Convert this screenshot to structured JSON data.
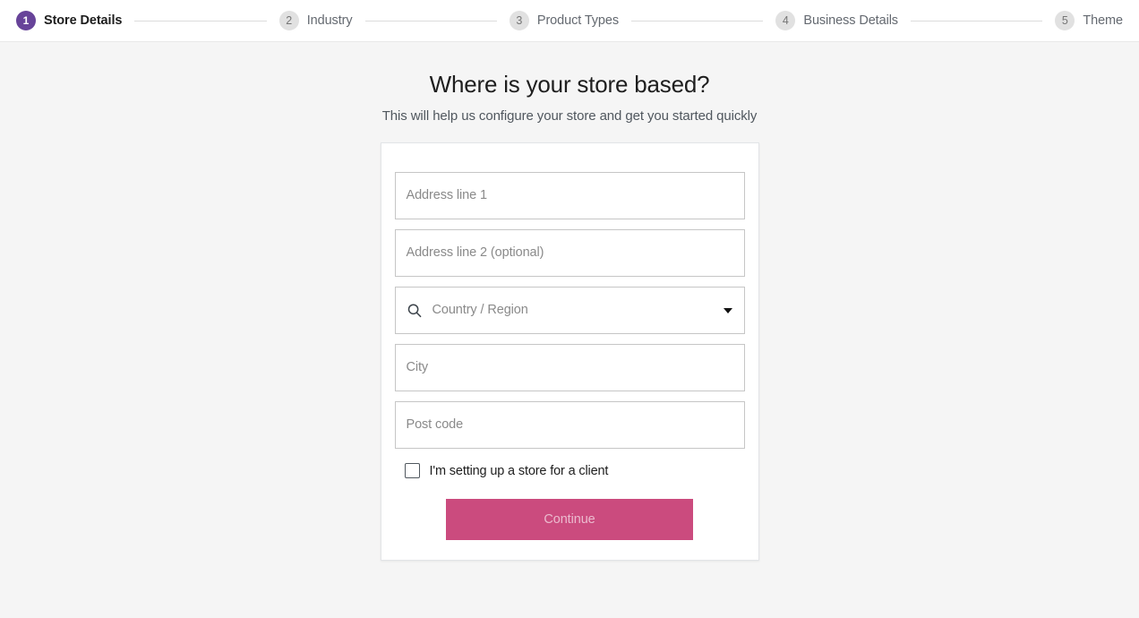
{
  "stepper": {
    "steps": [
      {
        "number": "1",
        "label": "Store Details",
        "state": "active"
      },
      {
        "number": "2",
        "label": "Industry",
        "state": "upcoming"
      },
      {
        "number": "3",
        "label": "Product Types",
        "state": "upcoming"
      },
      {
        "number": "4",
        "label": "Business Details",
        "state": "upcoming"
      },
      {
        "number": "5",
        "label": "Theme",
        "state": "upcoming"
      }
    ],
    "active_color": "#674399",
    "inactive_color": "#e1e1e1"
  },
  "main": {
    "title": "Where is your store based?",
    "subtitle": "This will help us configure your store and get you started quickly",
    "form": {
      "address_line_1": {
        "placeholder": "Address line 1",
        "value": ""
      },
      "address_line_2": {
        "placeholder": "Address line 2 (optional)",
        "value": ""
      },
      "country_region": {
        "placeholder": "Country / Region",
        "value": "",
        "search_icon": "search-icon",
        "caret_icon": "chevron-down-icon"
      },
      "city": {
        "placeholder": "City",
        "value": ""
      },
      "post_code": {
        "placeholder": "Post code",
        "value": ""
      },
      "client_checkbox": {
        "label": "I'm setting up a store for a client",
        "checked": false
      },
      "continue_button": {
        "label": "Continue",
        "color": "#cb4b7e",
        "disabled": true
      }
    }
  }
}
